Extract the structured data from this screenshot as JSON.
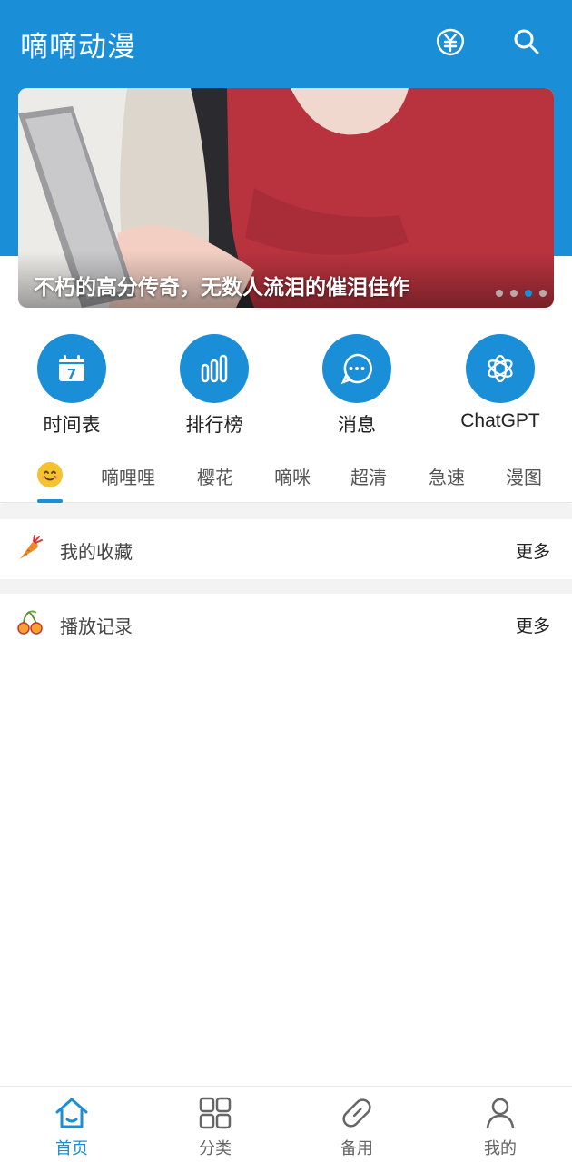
{
  "header": {
    "title": "嘀嘀动漫",
    "icons": [
      "yen-coin-icon",
      "search-icon"
    ],
    "background_color": "#1a8fd8"
  },
  "banner": {
    "caption": "不朽的高分传奇，无数人流泪的催泪佳作",
    "dot_count": 4,
    "active_dot": 3
  },
  "shortcuts": [
    {
      "label": "时间表",
      "icon": "calendar-icon",
      "badge": "7"
    },
    {
      "label": "排行榜",
      "icon": "bar-chart-icon"
    },
    {
      "label": "消息",
      "icon": "message-bubble-icon"
    },
    {
      "label": "ChatGPT",
      "icon": "openai-logo-icon"
    }
  ],
  "tabs": {
    "active_index": 0,
    "items": [
      "emoji-smile",
      "嘀哩哩",
      "樱花",
      "嘀咪",
      "超清",
      "急速",
      "漫图"
    ]
  },
  "sections": [
    {
      "title": "我的收藏",
      "more": "更多",
      "icon": "carrot-icon"
    },
    {
      "title": "播放记录",
      "more": "更多",
      "icon": "cherry-icon"
    }
  ],
  "bottom_nav": {
    "active_index": 0,
    "items": [
      {
        "label": "首页",
        "icon": "home-icon"
      },
      {
        "label": "分类",
        "icon": "grid-icon"
      },
      {
        "label": "备用",
        "icon": "pill-icon"
      },
      {
        "label": "我的",
        "icon": "user-icon"
      }
    ]
  },
  "accent_color": "#1a8fd8"
}
